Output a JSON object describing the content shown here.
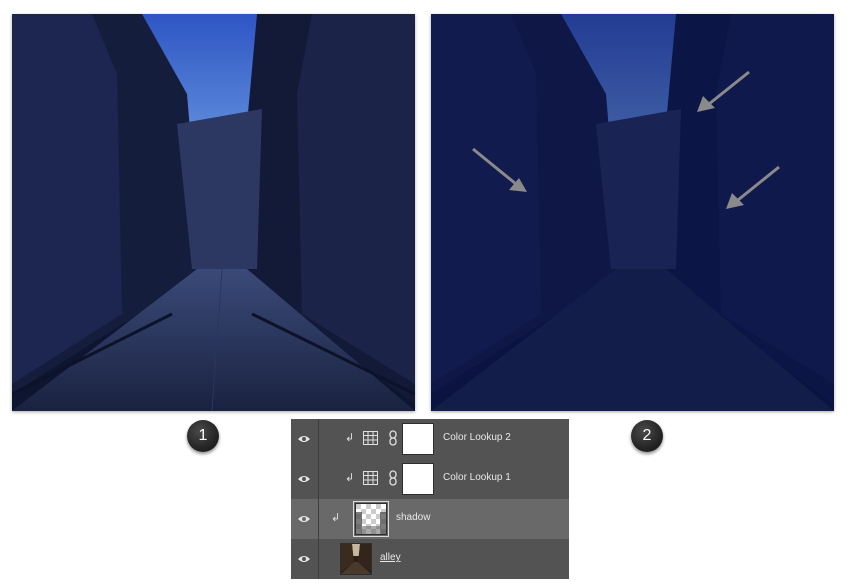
{
  "steps": {
    "first_label": "1",
    "second_label": "2"
  },
  "panels": [
    {
      "image": "dark-blue-alley-photo",
      "annotations": []
    },
    {
      "image": "darker-blue-alley-photo",
      "annotations": [
        "arrow-icon",
        "arrow-icon",
        "arrow-icon"
      ]
    }
  ],
  "layers_panel": {
    "layers": [
      {
        "name": "Color Lookup 2",
        "type": "adjustment",
        "clipped": true,
        "visible": true
      },
      {
        "name": "Color Lookup 1",
        "type": "adjustment",
        "clipped": true,
        "visible": true
      },
      {
        "name": "shadow",
        "type": "pixel",
        "clipped": true,
        "visible": true,
        "selected": true
      },
      {
        "name": "alley",
        "type": "image",
        "clipped": false,
        "visible": true
      }
    ]
  },
  "colors": {
    "panel_bg": "#535353",
    "selected_row": "#696969",
    "sky": "#3a64c8",
    "night_blue": "#0d1a45"
  }
}
